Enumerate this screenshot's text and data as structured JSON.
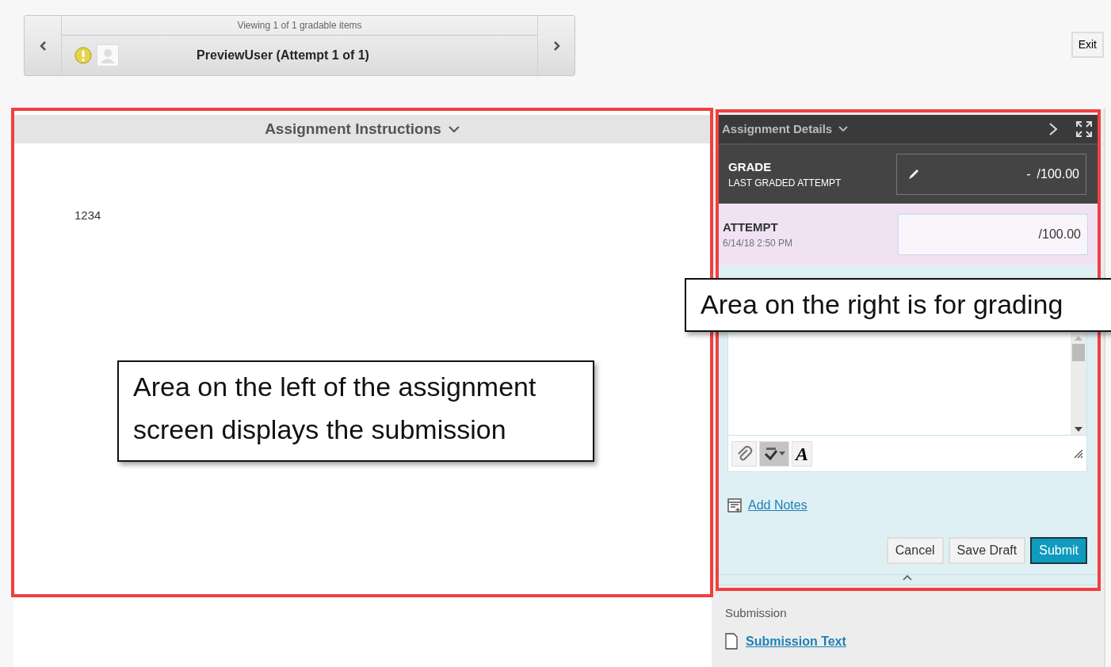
{
  "navigator": {
    "caption": "Viewing 1 of 1 gradable items",
    "student": "PreviewUser (Attempt 1 of 1)"
  },
  "exit_button": "Exit",
  "instructions_panel": {
    "title": "Assignment Instructions",
    "content": "1234"
  },
  "details_panel": {
    "title": "Assignment Details",
    "grade": {
      "label": "GRADE",
      "sublabel": "LAST GRADED ATTEMPT",
      "value": "-",
      "out_of": "/100.00"
    },
    "attempt": {
      "label": "ATTEMPT",
      "date": "6/14/18 2:50 PM",
      "out_of": "/100.00"
    },
    "toolbar": [
      {
        "kind": "attach",
        "pressed": false
      },
      {
        "kind": "spellcheck",
        "pressed": true
      },
      {
        "kind": "format",
        "label": "A",
        "pressed": false
      }
    ],
    "add_notes": "Add Notes",
    "buttons": [
      {
        "label": "Cancel",
        "kind": "default"
      },
      {
        "label": "Save Draft",
        "kind": "default"
      },
      {
        "label": "Submit",
        "kind": "primary"
      }
    ]
  },
  "submission": {
    "heading": "Submission",
    "file": "Submission Text"
  },
  "annotations": [
    {
      "text": "Area on the left of the assignment screen displays the submission"
    },
    {
      "text": "Area on the right is for grading"
    }
  ]
}
